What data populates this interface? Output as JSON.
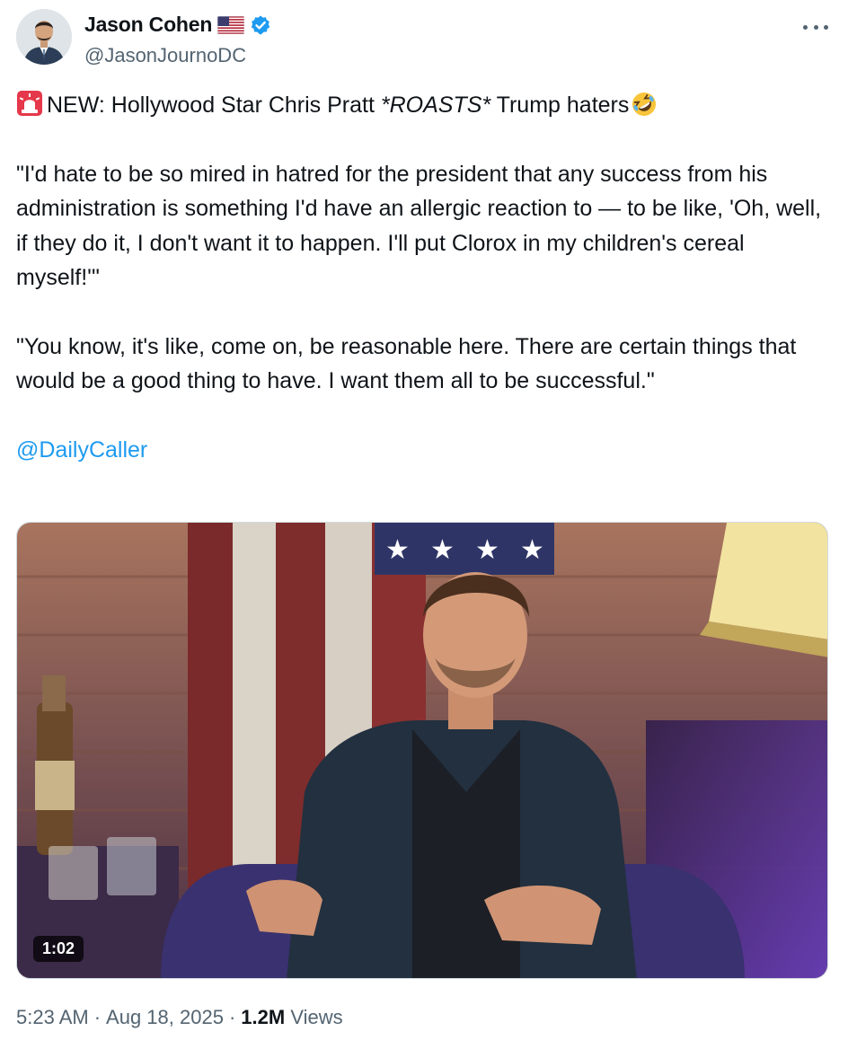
{
  "author": {
    "display_name": "Jason Cohen",
    "handle": "@JasonJournoDC",
    "verified": true,
    "flag_icon": "us-flag-icon"
  },
  "tweet": {
    "headline_prefix": "NEW: Hollywood Star Chris Pratt ",
    "headline_emphasis": "*ROASTS*",
    "headline_suffix": " Trump haters",
    "quote_1": "\"I'd hate to be so mired in hatred for the president that any success from his administration is something I'd have an allergic reaction to — to be like, 'Oh, well, if they do it, I don't want it to happen. I'll put Clorox in my children's cereal myself!'\"",
    "quote_2": "\"You know, it's like, come on, be reasonable here. There are certain things that would be a good thing to have. I want them all to be successful.\"",
    "mention": "@DailyCaller"
  },
  "media": {
    "duration": "1:02"
  },
  "meta": {
    "time": "5:23 AM",
    "separator": "·",
    "date": "Aug 18, 2025",
    "separator_2": "·",
    "views_count": "1.2M",
    "views_label": "Views"
  },
  "colors": {
    "link": "#1d9bf0",
    "verified_badge": "#1d9bf0",
    "secondary_text": "#536471"
  }
}
